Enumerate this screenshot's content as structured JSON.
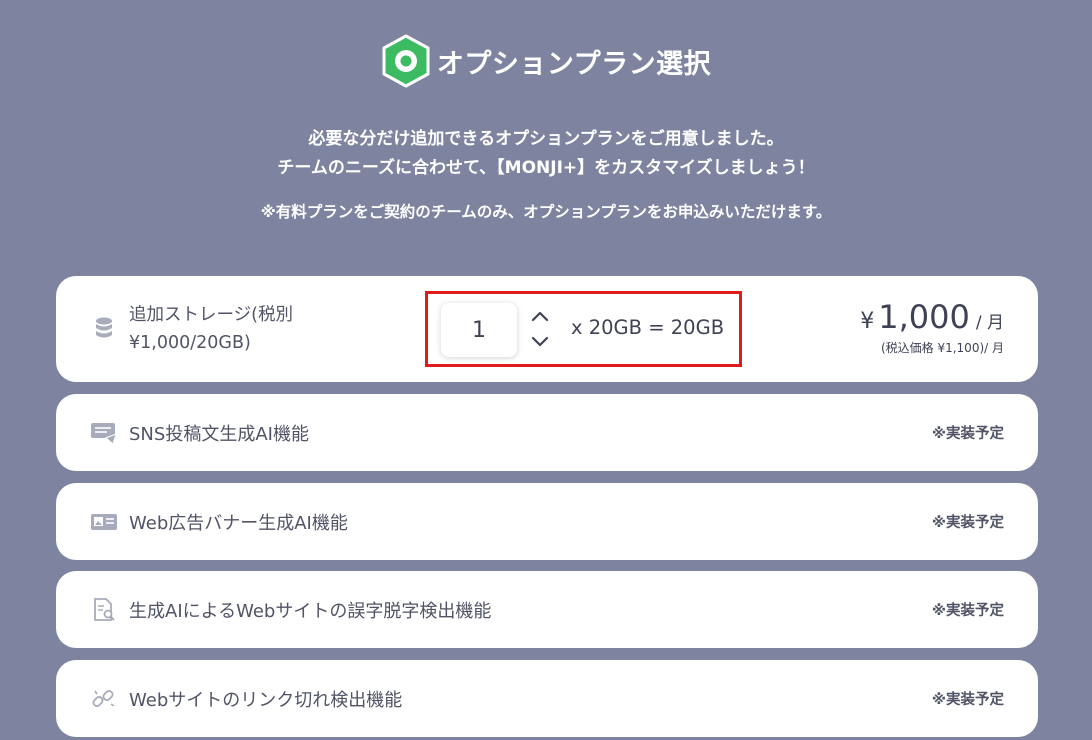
{
  "header": {
    "title": "オプションプラン選択",
    "intro_line1": "必要な分だけ追加できるオプションプランをご用意しました。",
    "intro_line2": "チームのニーズに合わせて、【MONJI+】をカスタマイズしましょう！",
    "notice": "※有料プランをご契約のチームのみ、オプションプランをお申込みいただけます。"
  },
  "storage": {
    "icon": "database-icon",
    "label_line1": "追加ストレージ(税別",
    "label_line2": "¥1,000/20GB)",
    "quantity": "1",
    "formula": "x 20GB = 20GB",
    "currency": "¥",
    "price": "1,000",
    "per": "/ 月",
    "price_incl": "(税込価格 ¥1,100)/ 月"
  },
  "features": [
    {
      "icon": "chat-post-icon",
      "label": "SNS投稿文生成AI機能",
      "status": "※実装予定"
    },
    {
      "icon": "image-banner-icon",
      "label": "Web広告バナー生成AI機能",
      "status": "※実装予定"
    },
    {
      "icon": "document-search-icon",
      "label": "生成AIによるWebサイトの誤字脱字検出機能",
      "status": "※実装予定"
    },
    {
      "icon": "link-broken-icon",
      "label": "Webサイトのリンク切れ検出機能",
      "status": "※実装予定"
    }
  ],
  "colors": {
    "background": "#7e849f",
    "accent_green": "#3dbb63",
    "highlight_red": "#e01b1b",
    "text": "#505466"
  }
}
